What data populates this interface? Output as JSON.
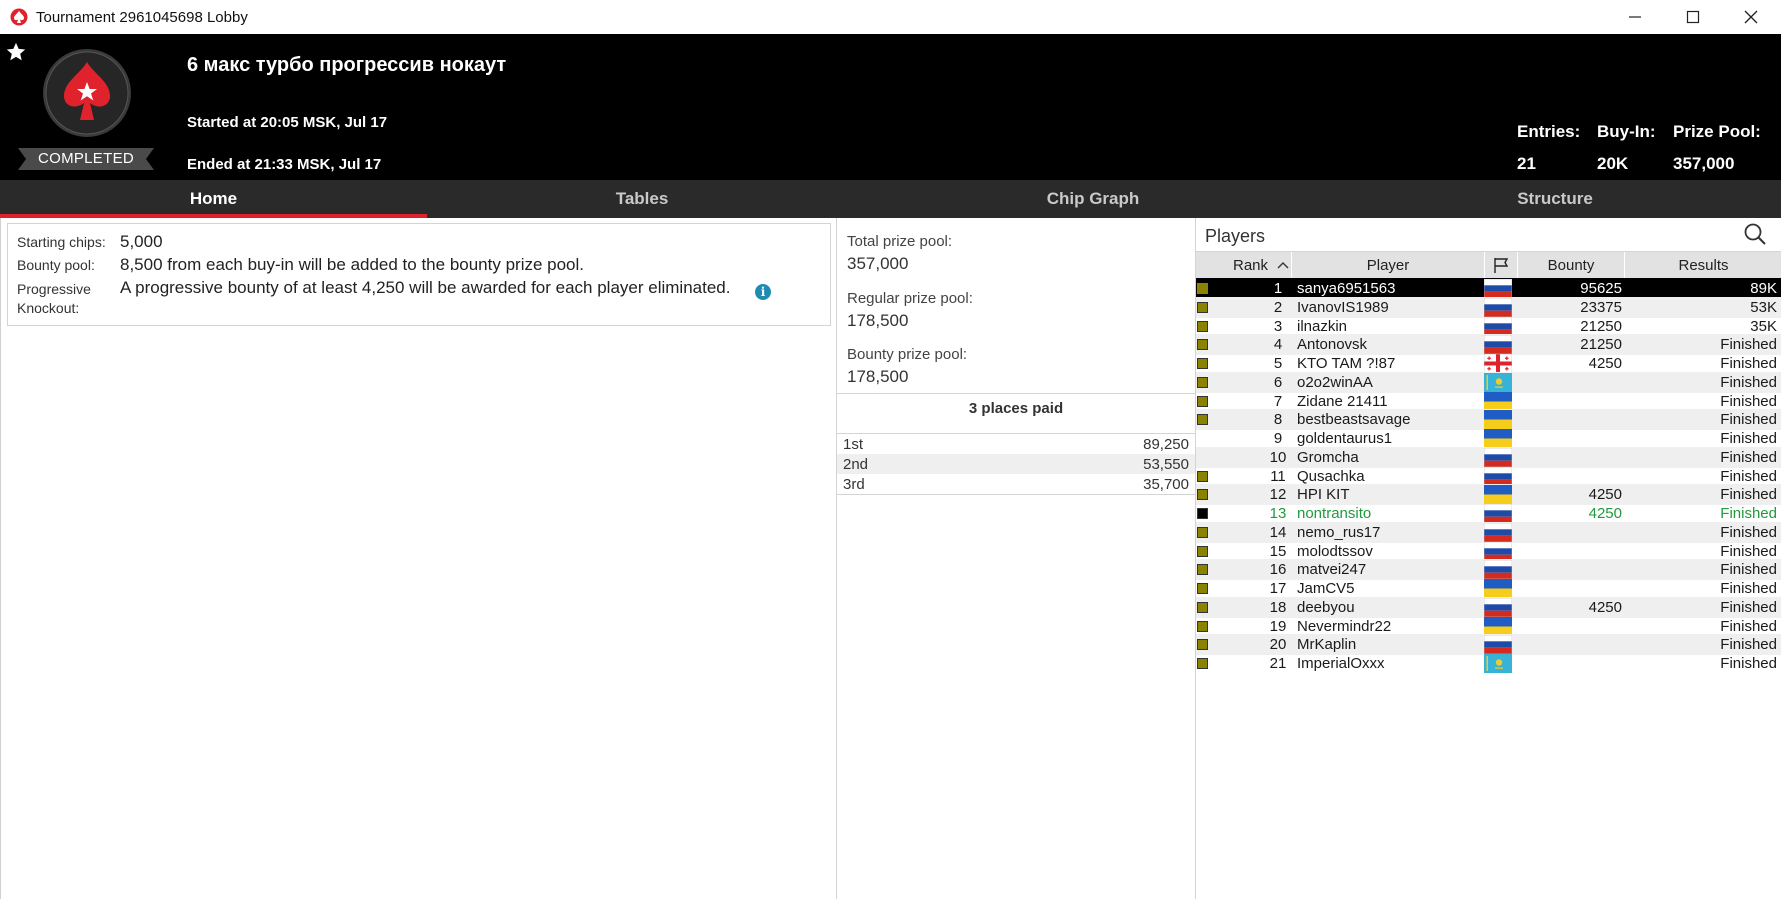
{
  "window": {
    "title": "Tournament 2961045698 Lobby"
  },
  "header": {
    "status_badge": "COMPLETED",
    "name": "6 макс турбо прогрессив нокаут",
    "started": "Started at 20:05 MSK, Jul 17",
    "ended": "Ended at 21:33 MSK, Jul 17",
    "stats": [
      {
        "label": "Entries:",
        "value": "21"
      },
      {
        "label": "Buy-In:",
        "value": "20K"
      },
      {
        "label": "Prize Pool:",
        "value": "357,000"
      }
    ]
  },
  "tabs": [
    {
      "label": "Home",
      "active": true
    },
    {
      "label": "Tables",
      "active": false
    },
    {
      "label": "Chip Graph",
      "active": false
    },
    {
      "label": "Structure",
      "active": false
    }
  ],
  "info": {
    "starting_chips_label": "Starting chips:",
    "starting_chips_value": "5,000",
    "bounty_pool_label": "Bounty pool:",
    "bounty_pool_value": "8,500 from each buy-in will be added to the bounty prize pool.",
    "pko_label_line1": "Progressive",
    "pko_label_line2": "Knockout:",
    "pko_value": "A progressive bounty of at least 4,250 will be awarded for each player eliminated.",
    "info_icon": "i"
  },
  "prize": {
    "total_label": "Total prize pool:",
    "total_value": "357,000",
    "regular_label": "Regular prize pool:",
    "regular_value": "178,500",
    "bounty_label": "Bounty prize pool:",
    "bounty_value": "178,500",
    "places_title": "3 places paid",
    "payouts": [
      {
        "place": "1st",
        "amount": "89,250"
      },
      {
        "place": "2nd",
        "amount": "53,550"
      },
      {
        "place": "3rd",
        "amount": "35,700"
      }
    ]
  },
  "players": {
    "title": "Players",
    "columns": {
      "rank": "Rank",
      "player": "Player",
      "bounty": "Bounty",
      "results": "Results"
    },
    "rows": [
      {
        "rank": "1",
        "name": "sanya6951563",
        "flag": "ru",
        "bounty": "95625",
        "result": "89K",
        "marker": "olive"
      },
      {
        "rank": "2",
        "name": "IvanovIS1989",
        "flag": "ru",
        "bounty": "23375",
        "result": "53K",
        "marker": "olive"
      },
      {
        "rank": "3",
        "name": "ilnazkin",
        "flag": "ru",
        "bounty": "21250",
        "result": "35K",
        "marker": "olive"
      },
      {
        "rank": "4",
        "name": "Antonovsk",
        "flag": "ru",
        "bounty": "21250",
        "result": "Finished",
        "marker": "olive"
      },
      {
        "rank": "5",
        "name": "KTO TAM ?!87",
        "flag": "ge",
        "bounty": "4250",
        "result": "Finished",
        "marker": "olive"
      },
      {
        "rank": "6",
        "name": "o2o2winAA",
        "flag": "kz",
        "bounty": "",
        "result": "Finished",
        "marker": "olive"
      },
      {
        "rank": "7",
        "name": "Zidane 21411",
        "flag": "ua",
        "bounty": "",
        "result": "Finished",
        "marker": "olive"
      },
      {
        "rank": "8",
        "name": "bestbeastsavage",
        "flag": "ua",
        "bounty": "",
        "result": "Finished",
        "marker": "olive"
      },
      {
        "rank": "9",
        "name": "goldentaurus1",
        "flag": "ua",
        "bounty": "",
        "result": "Finished",
        "marker": "none"
      },
      {
        "rank": "10",
        "name": "Gromcha",
        "flag": "ru",
        "bounty": "",
        "result": "Finished",
        "marker": "none"
      },
      {
        "rank": "11",
        "name": "Qusachka",
        "flag": "ru",
        "bounty": "",
        "result": "Finished",
        "marker": "olive"
      },
      {
        "rank": "12",
        "name": "HPI KIT",
        "flag": "ua",
        "bounty": "4250",
        "result": "Finished",
        "marker": "olive"
      },
      {
        "rank": "13",
        "name": "nontransito",
        "flag": "ru",
        "bounty": "4250",
        "result": "Finished",
        "marker": "black"
      },
      {
        "rank": "14",
        "name": "nemo_rus17",
        "flag": "ru",
        "bounty": "",
        "result": "Finished",
        "marker": "olive"
      },
      {
        "rank": "15",
        "name": "molodtssov",
        "flag": "ru",
        "bounty": "",
        "result": "Finished",
        "marker": "olive"
      },
      {
        "rank": "16",
        "name": "matvei247",
        "flag": "ru",
        "bounty": "",
        "result": "Finished",
        "marker": "olive"
      },
      {
        "rank": "17",
        "name": "JamCV5",
        "flag": "ua",
        "bounty": "",
        "result": "Finished",
        "marker": "olive"
      },
      {
        "rank": "18",
        "name": "deebyou",
        "flag": "ru",
        "bounty": "4250",
        "result": "Finished",
        "marker": "olive"
      },
      {
        "rank": "19",
        "name": "Nevermindr22",
        "flag": "ua",
        "bounty": "",
        "result": "Finished",
        "marker": "olive"
      },
      {
        "rank": "20",
        "name": "MrKaplin",
        "flag": "ru",
        "bounty": "",
        "result": "Finished",
        "marker": "olive"
      },
      {
        "rank": "21",
        "name": "ImperialOxxx",
        "flag": "kz",
        "bounty": "",
        "result": "Finished",
        "marker": "olive"
      }
    ]
  },
  "colors": {
    "accent_red": "#e0222d",
    "header_bg": "#000000",
    "tab_bg": "#2a2a2a",
    "highlight_green": "#1f9a3c",
    "marker_olive": "#8a8200",
    "info_blue": "#1e8bb0"
  },
  "icons": {
    "app": "pokerstars-spade-icon",
    "favorite": "star-icon",
    "logo": "pokerstars-logo-icon",
    "search": "search-icon",
    "sort": "chevron-up-icon",
    "country": "flag-icon",
    "minimize": "minimize-icon",
    "maximize": "maximize-icon",
    "close": "close-icon"
  }
}
